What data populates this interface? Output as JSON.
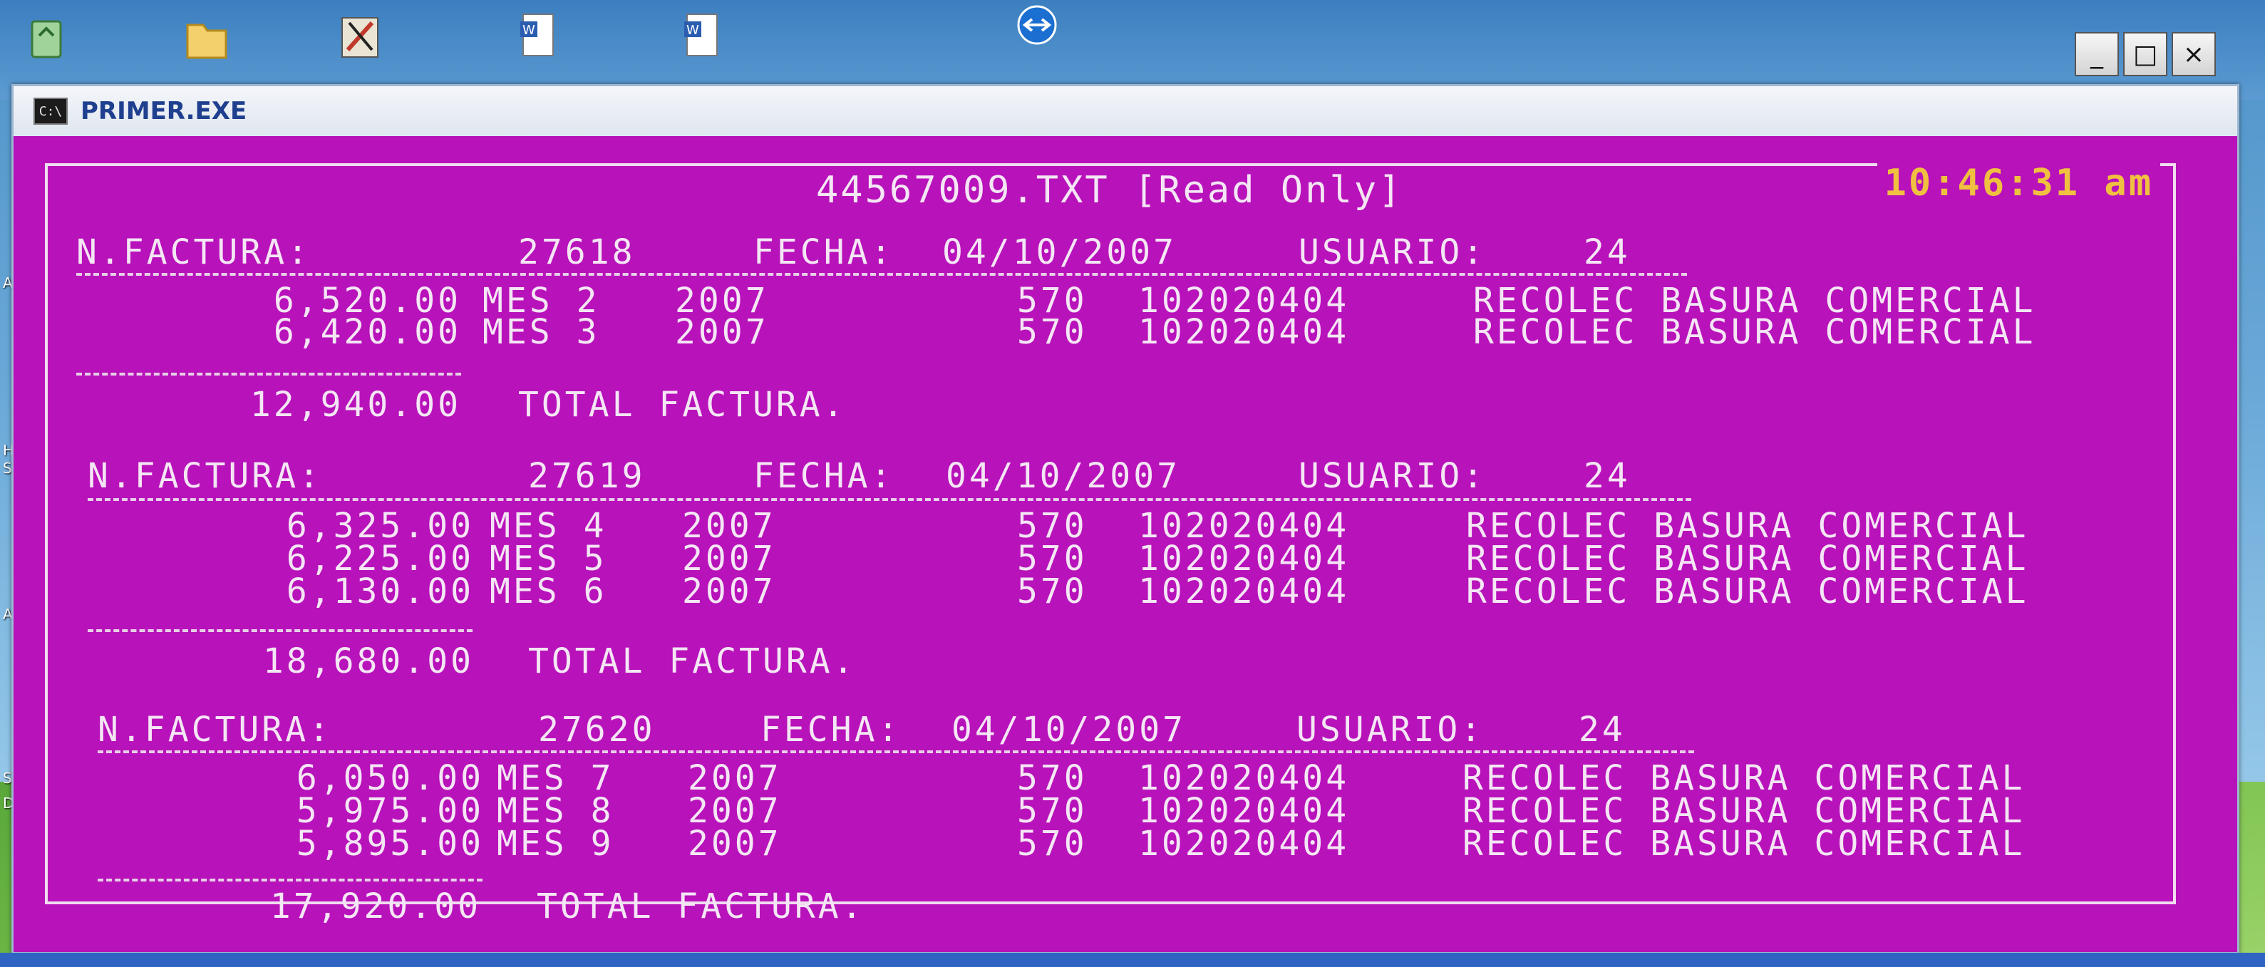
{
  "window": {
    "title": "PRIMER.EXE",
    "icon_text": "C:\\",
    "buttons": [
      "_",
      "□",
      "×"
    ]
  },
  "console": {
    "header": "44567009.TXT [Read Only]",
    "clock": "10:46:31 am",
    "invoices": [
      {
        "n_label": "N.FACTURA:",
        "number": "27618",
        "fecha_label": "FECHA:",
        "fecha": "04/10/2007",
        "usuario_label": "USUARIO:",
        "usuario": "24",
        "lines": [
          {
            "amount": "6,520.00",
            "mes": "MES 2",
            "year": "2007",
            "code": "570",
            "account": "102020404",
            "desc": "RECOLEC BASURA COMERCIAL"
          },
          {
            "amount": "6,420.00",
            "mes": "MES 3",
            "year": "2007",
            "code": "570",
            "account": "102020404",
            "desc": "RECOLEC BASURA COMERCIAL"
          }
        ],
        "total": "12,940.00",
        "total_label": "TOTAL FACTURA."
      },
      {
        "n_label": "N.FACTURA:",
        "number": "27619",
        "fecha_label": "FECHA:",
        "fecha": "04/10/2007",
        "usuario_label": "USUARIO:",
        "usuario": "24",
        "lines": [
          {
            "amount": "6,325.00",
            "mes": "MES 4",
            "year": "2007",
            "code": "570",
            "account": "102020404",
            "desc": "RECOLEC BASURA COMERCIAL"
          },
          {
            "amount": "6,225.00",
            "mes": "MES 5",
            "year": "2007",
            "code": "570",
            "account": "102020404",
            "desc": "RECOLEC BASURA COMERCIAL"
          },
          {
            "amount": "6,130.00",
            "mes": "MES 6",
            "year": "2007",
            "code": "570",
            "account": "102020404",
            "desc": "RECOLEC BASURA COMERCIAL"
          }
        ],
        "total": "18,680.00",
        "total_label": "TOTAL FACTURA."
      },
      {
        "n_label": "N.FACTURA:",
        "number": "27620",
        "fecha_label": "FECHA:",
        "fecha": "04/10/2007",
        "usuario_label": "USUARIO:",
        "usuario": "24",
        "lines": [
          {
            "amount": "6,050.00",
            "mes": "MES 7",
            "year": "2007",
            "code": "570",
            "account": "102020404",
            "desc": "RECOLEC BASURA COMERCIAL"
          },
          {
            "amount": "5,975.00",
            "mes": "MES 8",
            "year": "2007",
            "code": "570",
            "account": "102020404",
            "desc": "RECOLEC BASURA COMERCIAL"
          },
          {
            "amount": "5,895.00",
            "mes": "MES 9",
            "year": "2007",
            "code": "570",
            "account": "102020404",
            "desc": "RECOLEC BASURA COMERCIAL"
          }
        ],
        "total": "17,920.00",
        "total_label": "TOTAL FACTURA."
      }
    ]
  },
  "desktop": {
    "icons": [
      "recycle-bin-icon",
      "folder-icon",
      "tool-icon",
      "word-doc-icon",
      "word-doc-icon",
      "teamviewer-icon"
    ],
    "side_labels": [
      "A-",
      "HP",
      "Sca",
      "Ado",
      "Se",
      "Doc"
    ]
  },
  "colors": {
    "console_bg": "#b812ba",
    "console_text": "#f4e6f4",
    "clock": "#f0c040",
    "title_text": "#1f3f8f"
  }
}
